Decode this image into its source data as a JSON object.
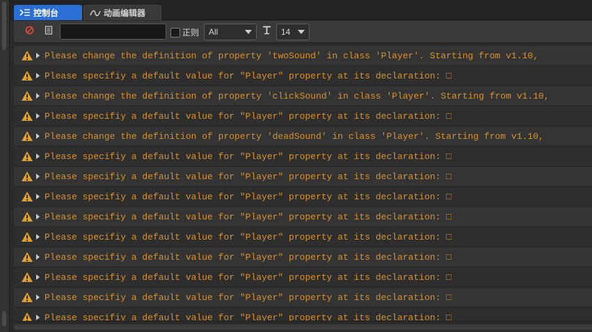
{
  "tabs": [
    {
      "label": "控制台",
      "icon": "terminal-icon",
      "active": true
    },
    {
      "label": "动画编辑器",
      "icon": "animation-icon",
      "active": false
    }
  ],
  "toolbar": {
    "clear_icon": "clear-icon",
    "collapse_icon": "document-icon",
    "search_value": "",
    "search_placeholder": "",
    "regex_label": "正则",
    "level_value": "All",
    "font_icon": "font-size-icon",
    "font_size_value": "14"
  },
  "colors": {
    "accent": "#2a6fd6",
    "warning_text": "#d9922c",
    "warning_icon": "#e0a030"
  },
  "log": {
    "rows": [
      {
        "level": "warning",
        "text": "Please change the definition of property 'twoSound' in class 'Player'. Starting from v1.10,"
      },
      {
        "level": "warning",
        "text": "Please specifiy a default value for \"Player\" property at its declaration: □"
      },
      {
        "level": "warning",
        "text": "Please change the definition of property 'clickSound' in class 'Player'. Starting from v1.10,"
      },
      {
        "level": "warning",
        "text": "Please specifiy a default value for \"Player\" property at its declaration: □"
      },
      {
        "level": "warning",
        "text": "Please change the definition of property 'deadSound' in class 'Player'. Starting from v1.10,"
      },
      {
        "level": "warning",
        "text": "Please specifiy a default value for \"Player\" property at its declaration: □"
      },
      {
        "level": "warning",
        "text": "Please specifiy a default value for \"Player\" property at its declaration: □"
      },
      {
        "level": "warning",
        "text": "Please specifiy a default value for \"Player\" property at its declaration: □"
      },
      {
        "level": "warning",
        "text": "Please specifiy a default value for \"Player\" property at its declaration: □"
      },
      {
        "level": "warning",
        "text": "Please specifiy a default value for \"Player\" property at its declaration: □"
      },
      {
        "level": "warning",
        "text": "Please specifiy a default value for \"Player\" property at its declaration: □"
      },
      {
        "level": "warning",
        "text": "Please specifiy a default value for \"Player\" property at its declaration: □"
      },
      {
        "level": "warning",
        "text": "Please specifiy a default value for \"Player\" property at its declaration: □"
      },
      {
        "level": "warning",
        "text": "Please specifiy a default value for \"Player\" property at its declaration: □"
      }
    ]
  }
}
